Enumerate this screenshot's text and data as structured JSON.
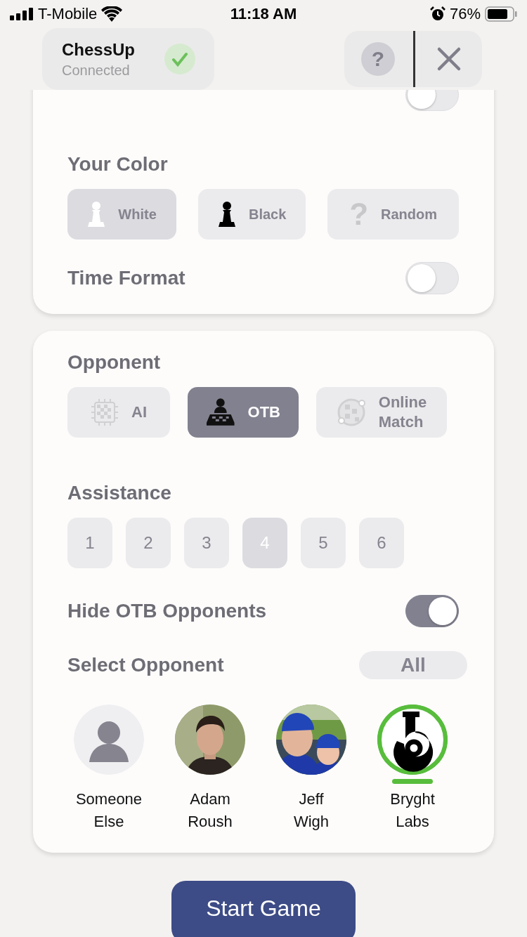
{
  "status_bar": {
    "carrier": "T-Mobile",
    "time": "11:18 AM",
    "battery": "76%"
  },
  "device": {
    "name": "ChessUp",
    "status": "Connected",
    "connected": true
  },
  "help_button": {
    "label": "?"
  },
  "hint_limit": {
    "on": false
  },
  "your_color": {
    "label": "Your Color",
    "options": [
      {
        "kind": "white",
        "label": "White",
        "selected": true
      },
      {
        "kind": "black",
        "label": "Black",
        "selected": false
      },
      {
        "kind": "random",
        "label": "Random",
        "icon": "?",
        "selected": false
      }
    ]
  },
  "time_format": {
    "label": "Time Format",
    "on": false
  },
  "opponent": {
    "label": "Opponent",
    "options": [
      {
        "kind": "ai",
        "label": "AI",
        "selected": false
      },
      {
        "kind": "otb",
        "label": "OTB",
        "selected": true
      },
      {
        "kind": "online",
        "label": "Online Match",
        "selected": false
      }
    ]
  },
  "assistance": {
    "label": "Assistance",
    "levels": [
      {
        "label": "1",
        "selected": false
      },
      {
        "label": "2",
        "selected": false
      },
      {
        "label": "3",
        "selected": false
      },
      {
        "label": "4",
        "selected": true
      },
      {
        "label": "5",
        "selected": false
      },
      {
        "label": "6",
        "selected": false
      }
    ]
  },
  "hide_otb": {
    "label": "Hide OTB Opponents",
    "on": true
  },
  "select_opponent": {
    "label": "Select Opponent",
    "filter": "All",
    "players": [
      {
        "kind": "placeholder",
        "name": "Someone Else",
        "selected": false
      },
      {
        "kind": "picture",
        "name": "Adam Roush",
        "selected": false
      },
      {
        "kind": "picture",
        "name": "Jeff Wigh",
        "selected": false
      },
      {
        "kind": "logo",
        "name": "Bryght Labs",
        "selected": true
      }
    ]
  },
  "start_button": {
    "label": "Start Game"
  }
}
